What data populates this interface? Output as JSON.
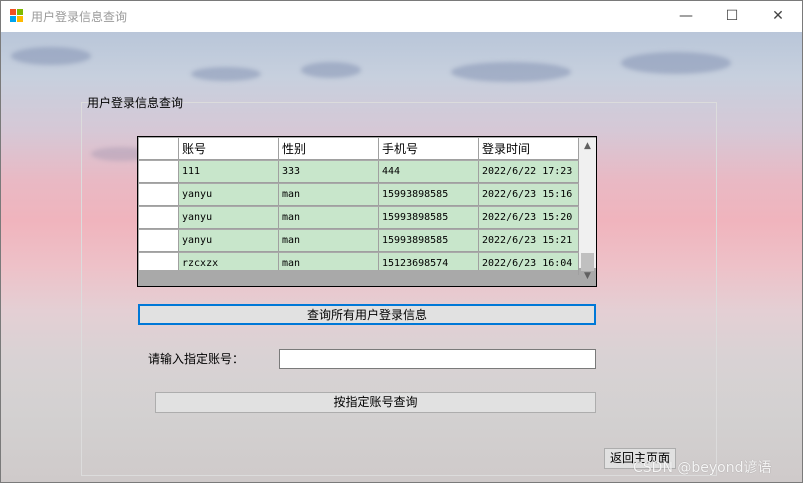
{
  "window": {
    "title": "用户登录信息查询",
    "minimize_glyph": "—",
    "maximize_glyph": "☐",
    "close_glyph": "✕"
  },
  "group": {
    "label": "用户登录信息查询"
  },
  "grid": {
    "columns": [
      "账号",
      "性别",
      "手机号",
      "登录时间"
    ],
    "rows": [
      [
        "111",
        "333",
        "444",
        "2022/6/22 17:23"
      ],
      [
        "yanyu",
        "man",
        "15993898585",
        "2022/6/23 15:16"
      ],
      [
        "yanyu",
        "man",
        "15993898585",
        "2022/6/23 15:20"
      ],
      [
        "yanyu",
        "man",
        "15993898585",
        "2022/6/23 15:21"
      ],
      [
        "rzcxzx",
        "man",
        "15123698574",
        "2022/6/23 16:04"
      ]
    ],
    "row_color": "#c8e6cb"
  },
  "buttons": {
    "query_all": "查询所有用户登录信息",
    "query_by_account": "按指定账号查询",
    "back_home": "返回主页面"
  },
  "account_input": {
    "label": "请输入指定账号：",
    "value": ""
  },
  "watermark": "CSDN @beyond谚语",
  "colors": {
    "focus_border": "#0078d7",
    "button_face": "#e1e1e1"
  }
}
